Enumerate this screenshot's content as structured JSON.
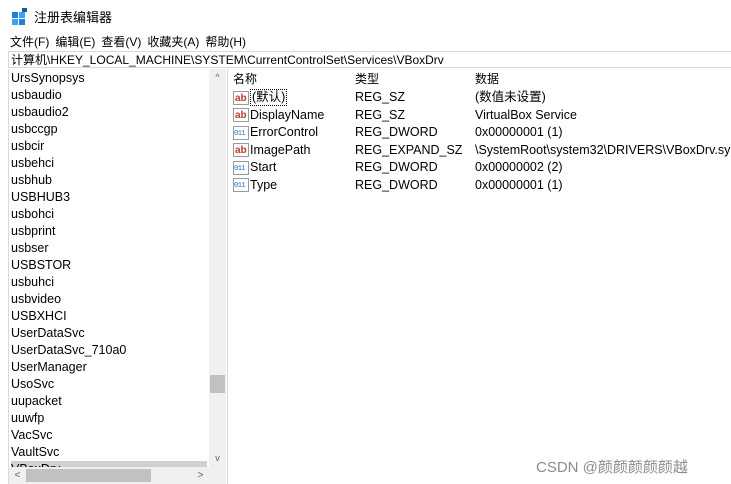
{
  "window": {
    "title": "注册表编辑器",
    "icon": "regedit-icon"
  },
  "menu": [
    "文件(F)",
    "编辑(E)",
    "查看(V)",
    "收藏夹(A)",
    "帮助(H)"
  ],
  "address": "计算机\\HKEY_LOCAL_MACHINE\\SYSTEM\\CurrentControlSet\\Services\\VBoxDrv",
  "tree": {
    "items": [
      "UrsSynopsys",
      "usbaudio",
      "usbaudio2",
      "usbccgp",
      "usbcir",
      "usbehci",
      "usbhub",
      "USBHUB3",
      "usbohci",
      "usbprint",
      "usbser",
      "USBSTOR",
      "usbuhci",
      "usbvideo",
      "USBXHCI",
      "UserDataSvc",
      "UserDataSvc_710a0",
      "UserManager",
      "UsoSvc",
      "uupacket",
      "uuwfp",
      "VacSvc",
      "VaultSvc",
      "VBoxDrv"
    ],
    "selected": "VBoxDrv",
    "scroll_up": "^",
    "scroll_down": "v",
    "scroll_left": "<",
    "scroll_right": ">"
  },
  "values": {
    "columns": {
      "name": "名称",
      "type": "类型",
      "data": "数据"
    },
    "rows": [
      {
        "icon": "string-value-icon",
        "name": "(默认)",
        "type": "REG_SZ",
        "data": "(数值未设置)"
      },
      {
        "icon": "string-value-icon",
        "name": "DisplayName",
        "type": "REG_SZ",
        "data": "VirtualBox Service"
      },
      {
        "icon": "binary-value-icon",
        "name": "ErrorControl",
        "type": "REG_DWORD",
        "data": "0x00000001 (1)"
      },
      {
        "icon": "string-value-icon",
        "name": "ImagePath",
        "type": "REG_EXPAND_SZ",
        "data": "\\SystemRoot\\system32\\DRIVERS\\VBoxDrv.sy"
      },
      {
        "icon": "binary-value-icon",
        "name": "Start",
        "type": "REG_DWORD",
        "data": "0x00000002 (2)"
      },
      {
        "icon": "binary-value-icon",
        "name": "Type",
        "type": "REG_DWORD",
        "data": "0x00000001 (1)"
      }
    ]
  },
  "watermark": "CSDN @颜颜颜颜颜越"
}
